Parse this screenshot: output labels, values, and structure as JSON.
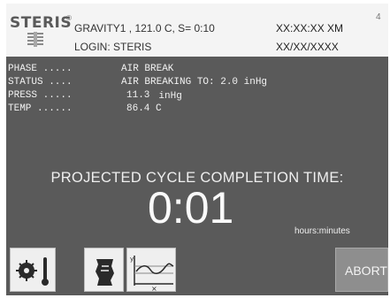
{
  "header": {
    "brand": "STERIS",
    "brand_mark": "®",
    "cycle_info": "GRAVITY1 , 121.0 C, S= 0:10",
    "login": "LOGIN: STERIS",
    "time": "XX:XX:XX XM",
    "date": "XX/XX/XXXX",
    "corner_mark": "4"
  },
  "status": {
    "phase_label": "PHASE .....",
    "phase_value": "AIR BREAK",
    "status_label": "STATUS ....",
    "status_value": "AIR BREAKING TO:  2.0 inHg",
    "press_label": "PRESS .....",
    "press_value": "11.3",
    "press_unit": "inHg",
    "temp_label": "TEMP ......",
    "temp_value": "86.4 C"
  },
  "completion": {
    "label": "PROJECTED CYCLE COMPLETION TIME:",
    "time": "0:01",
    "units": "hours:minutes"
  },
  "buttons": {
    "temperature_icon": "temperature-icon",
    "document_icon": "document-icon",
    "graph_icon": "graph-icon",
    "abort_label": "ABORT"
  },
  "colors": {
    "screen_bg": "#5a5a5a",
    "header_bg": "#f4f4f4",
    "abort_bg": "#8e8e8e"
  }
}
